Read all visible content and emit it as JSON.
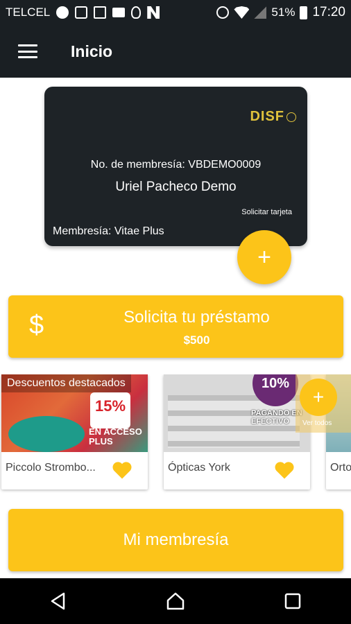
{
  "status_bar": {
    "carrier": "TELCEL",
    "battery": "51%",
    "time": "17:20",
    "icons": [
      "messenger-icon",
      "phone-icon",
      "image-icon",
      "clapper-icon",
      "bulb-icon",
      "n-logo-icon",
      "alarm-icon",
      "wifi-icon",
      "signal-icon",
      "battery-icon"
    ]
  },
  "app_bar": {
    "title": "Inicio",
    "menu_icon": "hamburger-icon"
  },
  "card": {
    "logo": "DISF",
    "membership_number": "No. de membresía: VBDEMO0009",
    "holder_name": "Uriel Pacheco Demo",
    "request_card": "Solicitar tarjeta",
    "membership_type": "Membresía:  Vitae Plus"
  },
  "fab": {
    "icon": "plus-icon",
    "symbol": "+"
  },
  "loan": {
    "icon": "dollar-icon",
    "symbol": "$",
    "title": "Solicita tu préstamo",
    "amount": "$500"
  },
  "discounts": {
    "label": "Descuentos destacados",
    "see_all": "Ver todos",
    "items": [
      {
        "name": "Piccolo Strombo...",
        "badge": "15%",
        "promo": "EN ACCESO PLUS"
      },
      {
        "name": "Ópticas York",
        "badge": "10%",
        "promo": "PAGANDO EN EFECTIVO"
      },
      {
        "name": "Orto"
      }
    ]
  },
  "membership_button": {
    "label": "Mi membresía"
  },
  "colors": {
    "accent": "#fcc419",
    "dark": "#1a1f23",
    "card": "#1e2327",
    "logo": "#e0c23c"
  }
}
